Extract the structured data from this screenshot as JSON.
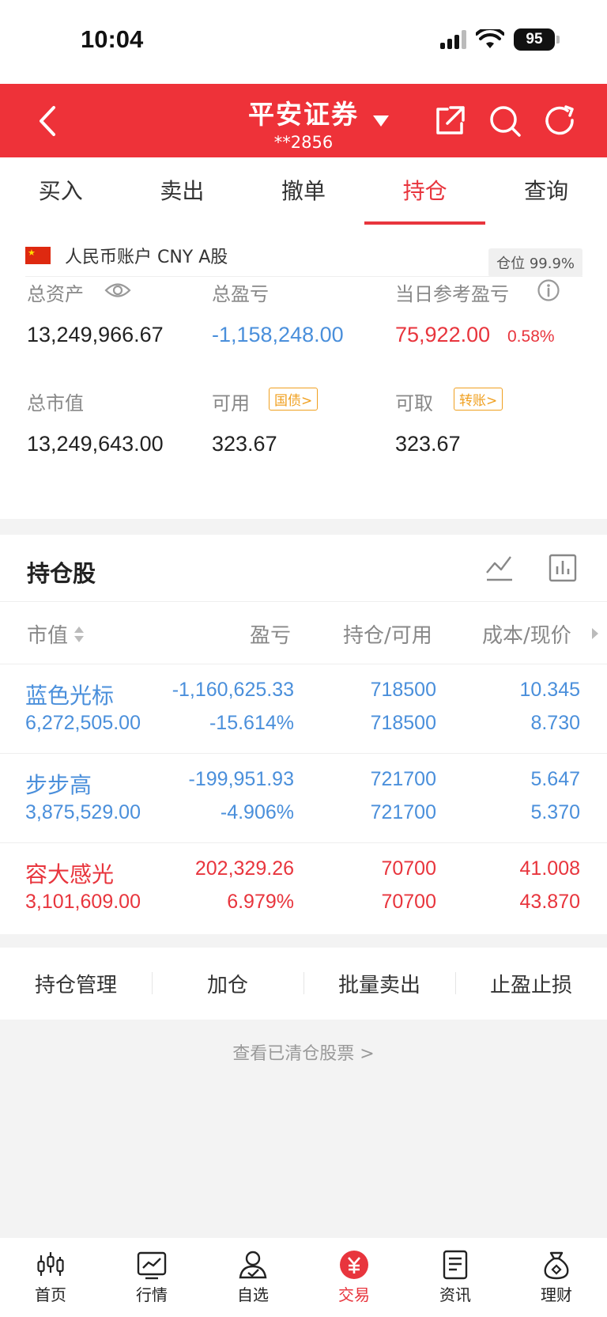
{
  "status": {
    "time": "10:04",
    "battery": "95"
  },
  "header": {
    "broker": "平安证券",
    "account": "**2856"
  },
  "tabs": [
    "买入",
    "卖出",
    "撤单",
    "持仓",
    "查询"
  ],
  "account": {
    "label": "人民币账户 CNY A股",
    "position_badge": "仓位 99.9%",
    "metrics": {
      "total_assets_label": "总资产",
      "total_assets": "13,249,966.67",
      "total_pl_label": "总盈亏",
      "total_pl": "-1,158,248.00",
      "daily_pl_label": "当日参考盈亏",
      "daily_pl": "75,922.00",
      "daily_pl_pct": "0.58%",
      "market_value_label": "总市值",
      "market_value": "13,249,643.00",
      "available_label": "可用",
      "available_tag": "国债>",
      "available": "323.67",
      "withdrawable_label": "可取",
      "withdrawable_tag": "转账>",
      "withdrawable": "323.67"
    }
  },
  "holdings": {
    "title": "持仓股",
    "columns": [
      "市值",
      "盈亏",
      "持仓/可用",
      "成本/现价"
    ],
    "rows": [
      {
        "name": "蓝色光标",
        "market_value": "6,272,505.00",
        "pl": "-1,160,625.33",
        "pl_pct": "-15.614%",
        "hold": "718500",
        "avail": "718500",
        "cost": "10.345",
        "price": "8.730",
        "trend": "down"
      },
      {
        "name": "步步高",
        "market_value": "3,875,529.00",
        "pl": "-199,951.93",
        "pl_pct": "-4.906%",
        "hold": "721700",
        "avail": "721700",
        "cost": "5.647",
        "price": "5.370",
        "trend": "down"
      },
      {
        "name": "容大感光",
        "market_value": "3,101,609.00",
        "pl": "202,329.26",
        "pl_pct": "6.979%",
        "hold": "70700",
        "avail": "70700",
        "cost": "41.008",
        "price": "43.870",
        "trend": "up"
      }
    ]
  },
  "actions": [
    "持仓管理",
    "加仓",
    "批量卖出",
    "止盈止损"
  ],
  "cleared_link": "查看已清仓股票 >",
  "tabbar": [
    "首页",
    "行情",
    "自选",
    "交易",
    "资讯",
    "理财"
  ],
  "colors": {
    "brand_red": "#ee3239",
    "gain": "#e8353d",
    "loss": "#4a8fdb",
    "tag": "#f0a020"
  }
}
